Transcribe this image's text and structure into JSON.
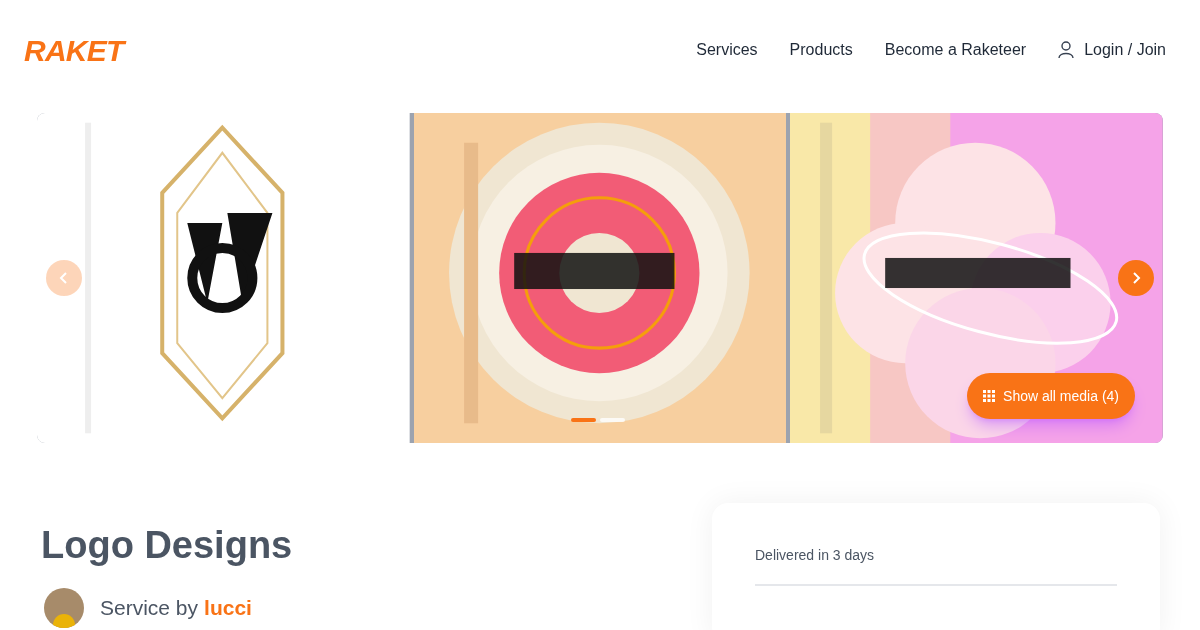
{
  "header": {
    "logo": "RAKET",
    "nav": [
      {
        "label": "Services",
        "kind": "link"
      },
      {
        "label": "Products",
        "kind": "link"
      },
      {
        "label": "Become a Raketeer",
        "kind": "link"
      },
      {
        "label": "Login / Join",
        "kind": "user"
      }
    ]
  },
  "gallery": {
    "prev": {
      "disabled": true
    },
    "next": {
      "disabled": false
    },
    "dots": [
      {
        "selected": true
      },
      {
        "selected": false
      }
    ],
    "show_all": "Show all media (4)"
  },
  "service": {
    "title": "Logo Designs",
    "by": "Service by",
    "seller": "lucci"
  },
  "order_card": {
    "delivery": "Delivered in 3 days"
  }
}
